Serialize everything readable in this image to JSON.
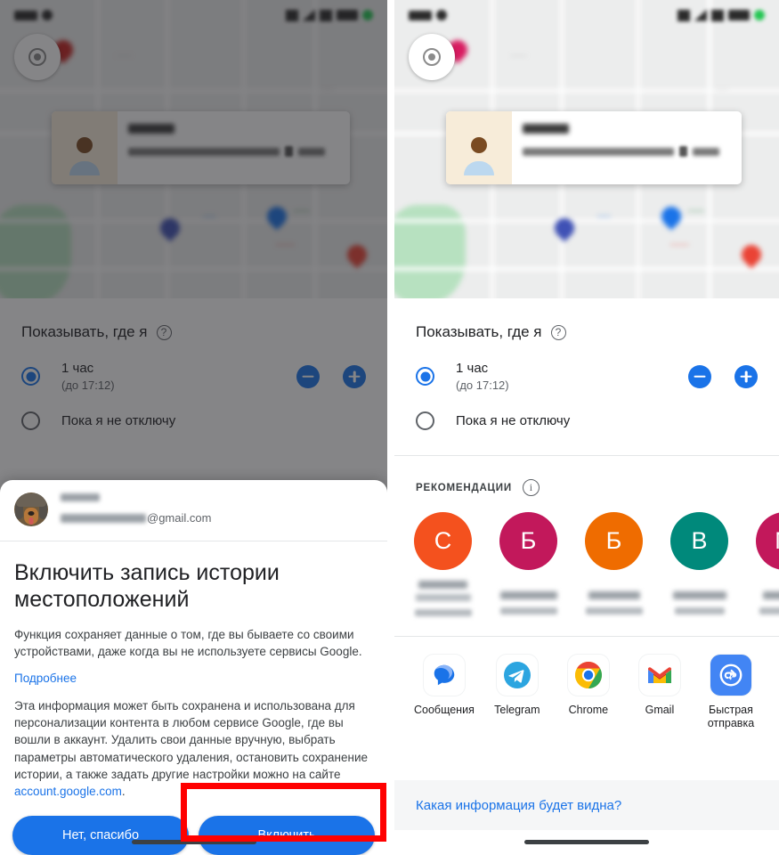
{
  "meta": {
    "accent_blue": "#1a73e8",
    "highlight_red": "#ff0000"
  },
  "left_panel": {
    "sheet": {
      "title": "Показывать, где я",
      "help_icon": "help-circle-icon",
      "options": [
        {
          "label": "1 час",
          "sub": "(до 17:12)",
          "selected": true
        },
        {
          "label": "Пока я не отключу",
          "sub": "",
          "selected": false
        }
      ],
      "stepper_minus": "minus-icon",
      "stepper_plus": "plus-icon"
    },
    "dialog": {
      "account": {
        "email_visible": "@gmail.com",
        "avatar": "dog-avatar"
      },
      "title": "Включить запись истории местоположений",
      "paragraph1": "Функция сохраняет данные о том, где вы бываете со своими устройствами, даже когда вы не используете сервисы Google.",
      "more_link": "Подробнее",
      "paragraph2_pre": "Эта информация может быть сохранена и использована для персонализации контента в любом сервисе Google, где вы вошли в аккаунт. Удалить свои данные вручную, выбрать параметры автоматического удаления, остановить сохранение истории, а также задать другие настройки можно на сайте ",
      "paragraph2_link": "account.google.com",
      "paragraph2_post": ".",
      "decline_button": "Нет, спасибо",
      "accept_button": "Включить"
    }
  },
  "right_panel": {
    "sheet": {
      "title": "Показывать, где я",
      "help_icon": "help-circle-icon",
      "options": [
        {
          "label": "1 час",
          "sub": "(до 17:12)",
          "selected": true
        },
        {
          "label": "Пока я не отключу",
          "sub": "",
          "selected": false
        }
      ],
      "stepper_minus": "minus-icon",
      "stepper_plus": "plus-icon"
    },
    "recommendations": {
      "label": "РЕКОМЕНДАЦИИ",
      "info_icon": "info-circle-icon",
      "contacts": [
        {
          "initial": "С",
          "color": "#f4511e"
        },
        {
          "initial": "Б",
          "color": "#c2185b"
        },
        {
          "initial": "Б",
          "color": "#ef6c00"
        },
        {
          "initial": "В",
          "color": "#00897b"
        },
        {
          "initial": "М",
          "color": "#c2185b"
        }
      ]
    },
    "apps": [
      {
        "name": "Сообщения",
        "icon": "messages-icon"
      },
      {
        "name": "Telegram",
        "icon": "telegram-icon"
      },
      {
        "name": "Chrome",
        "icon": "chrome-icon"
      },
      {
        "name": "Gmail",
        "icon": "gmail-icon"
      },
      {
        "name": "Быстрая отправка",
        "icon": "nearby-share-icon"
      }
    ],
    "bottom_link": "Какая информация будет видна?"
  }
}
